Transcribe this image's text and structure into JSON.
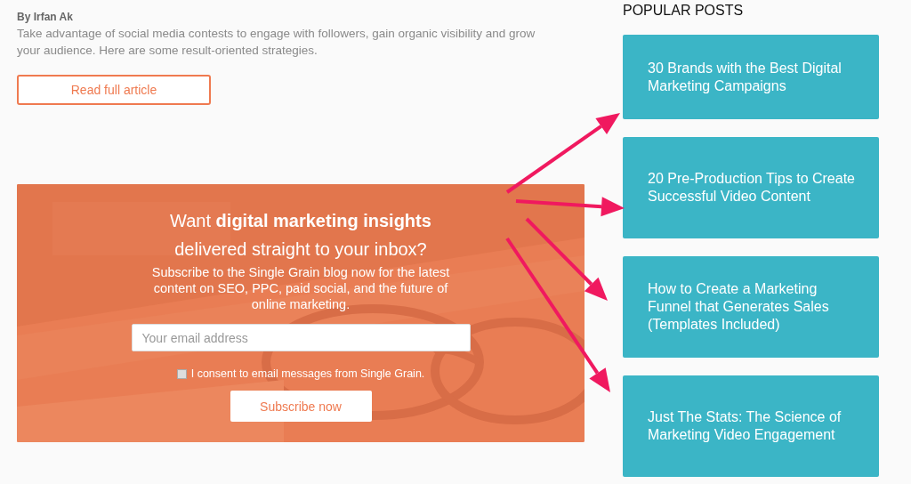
{
  "article": {
    "byline": "By Irfan Ak",
    "excerpt": "Take advantage of social media contests to engage with followers, gain organic visibility and grow your audience. Here are some result-oriented strategies.",
    "button": "Read full article"
  },
  "newsletter": {
    "heading": "Want **digital marketing insights** delivered straight to your inbox?",
    "text": "Subscribe to the Single Grain blog now for the latest content on SEO, PPC, paid social, and the future of online marketing.",
    "email": {
      "placeholder": "Your email address"
    },
    "consent": {
      "label": "I consent to email messages from Single Grain.",
      "checked": false
    },
    "button": "Subscribe now"
  },
  "popular_posts": {
    "title": "POPULAR POSTS",
    "posts": [
      {
        "title": "30 Brands with the Best Digital Marketing Campaigns"
      },
      {
        "title": "20 Pre-Production Tips to Create Successful Video Content"
      },
      {
        "title": "How to Create a Marketing Funnel that Generates Sales (Templates Included)"
      },
      {
        "title": "Just The Stats: The Science of Marketing Video Engagement"
      }
    ]
  }
}
